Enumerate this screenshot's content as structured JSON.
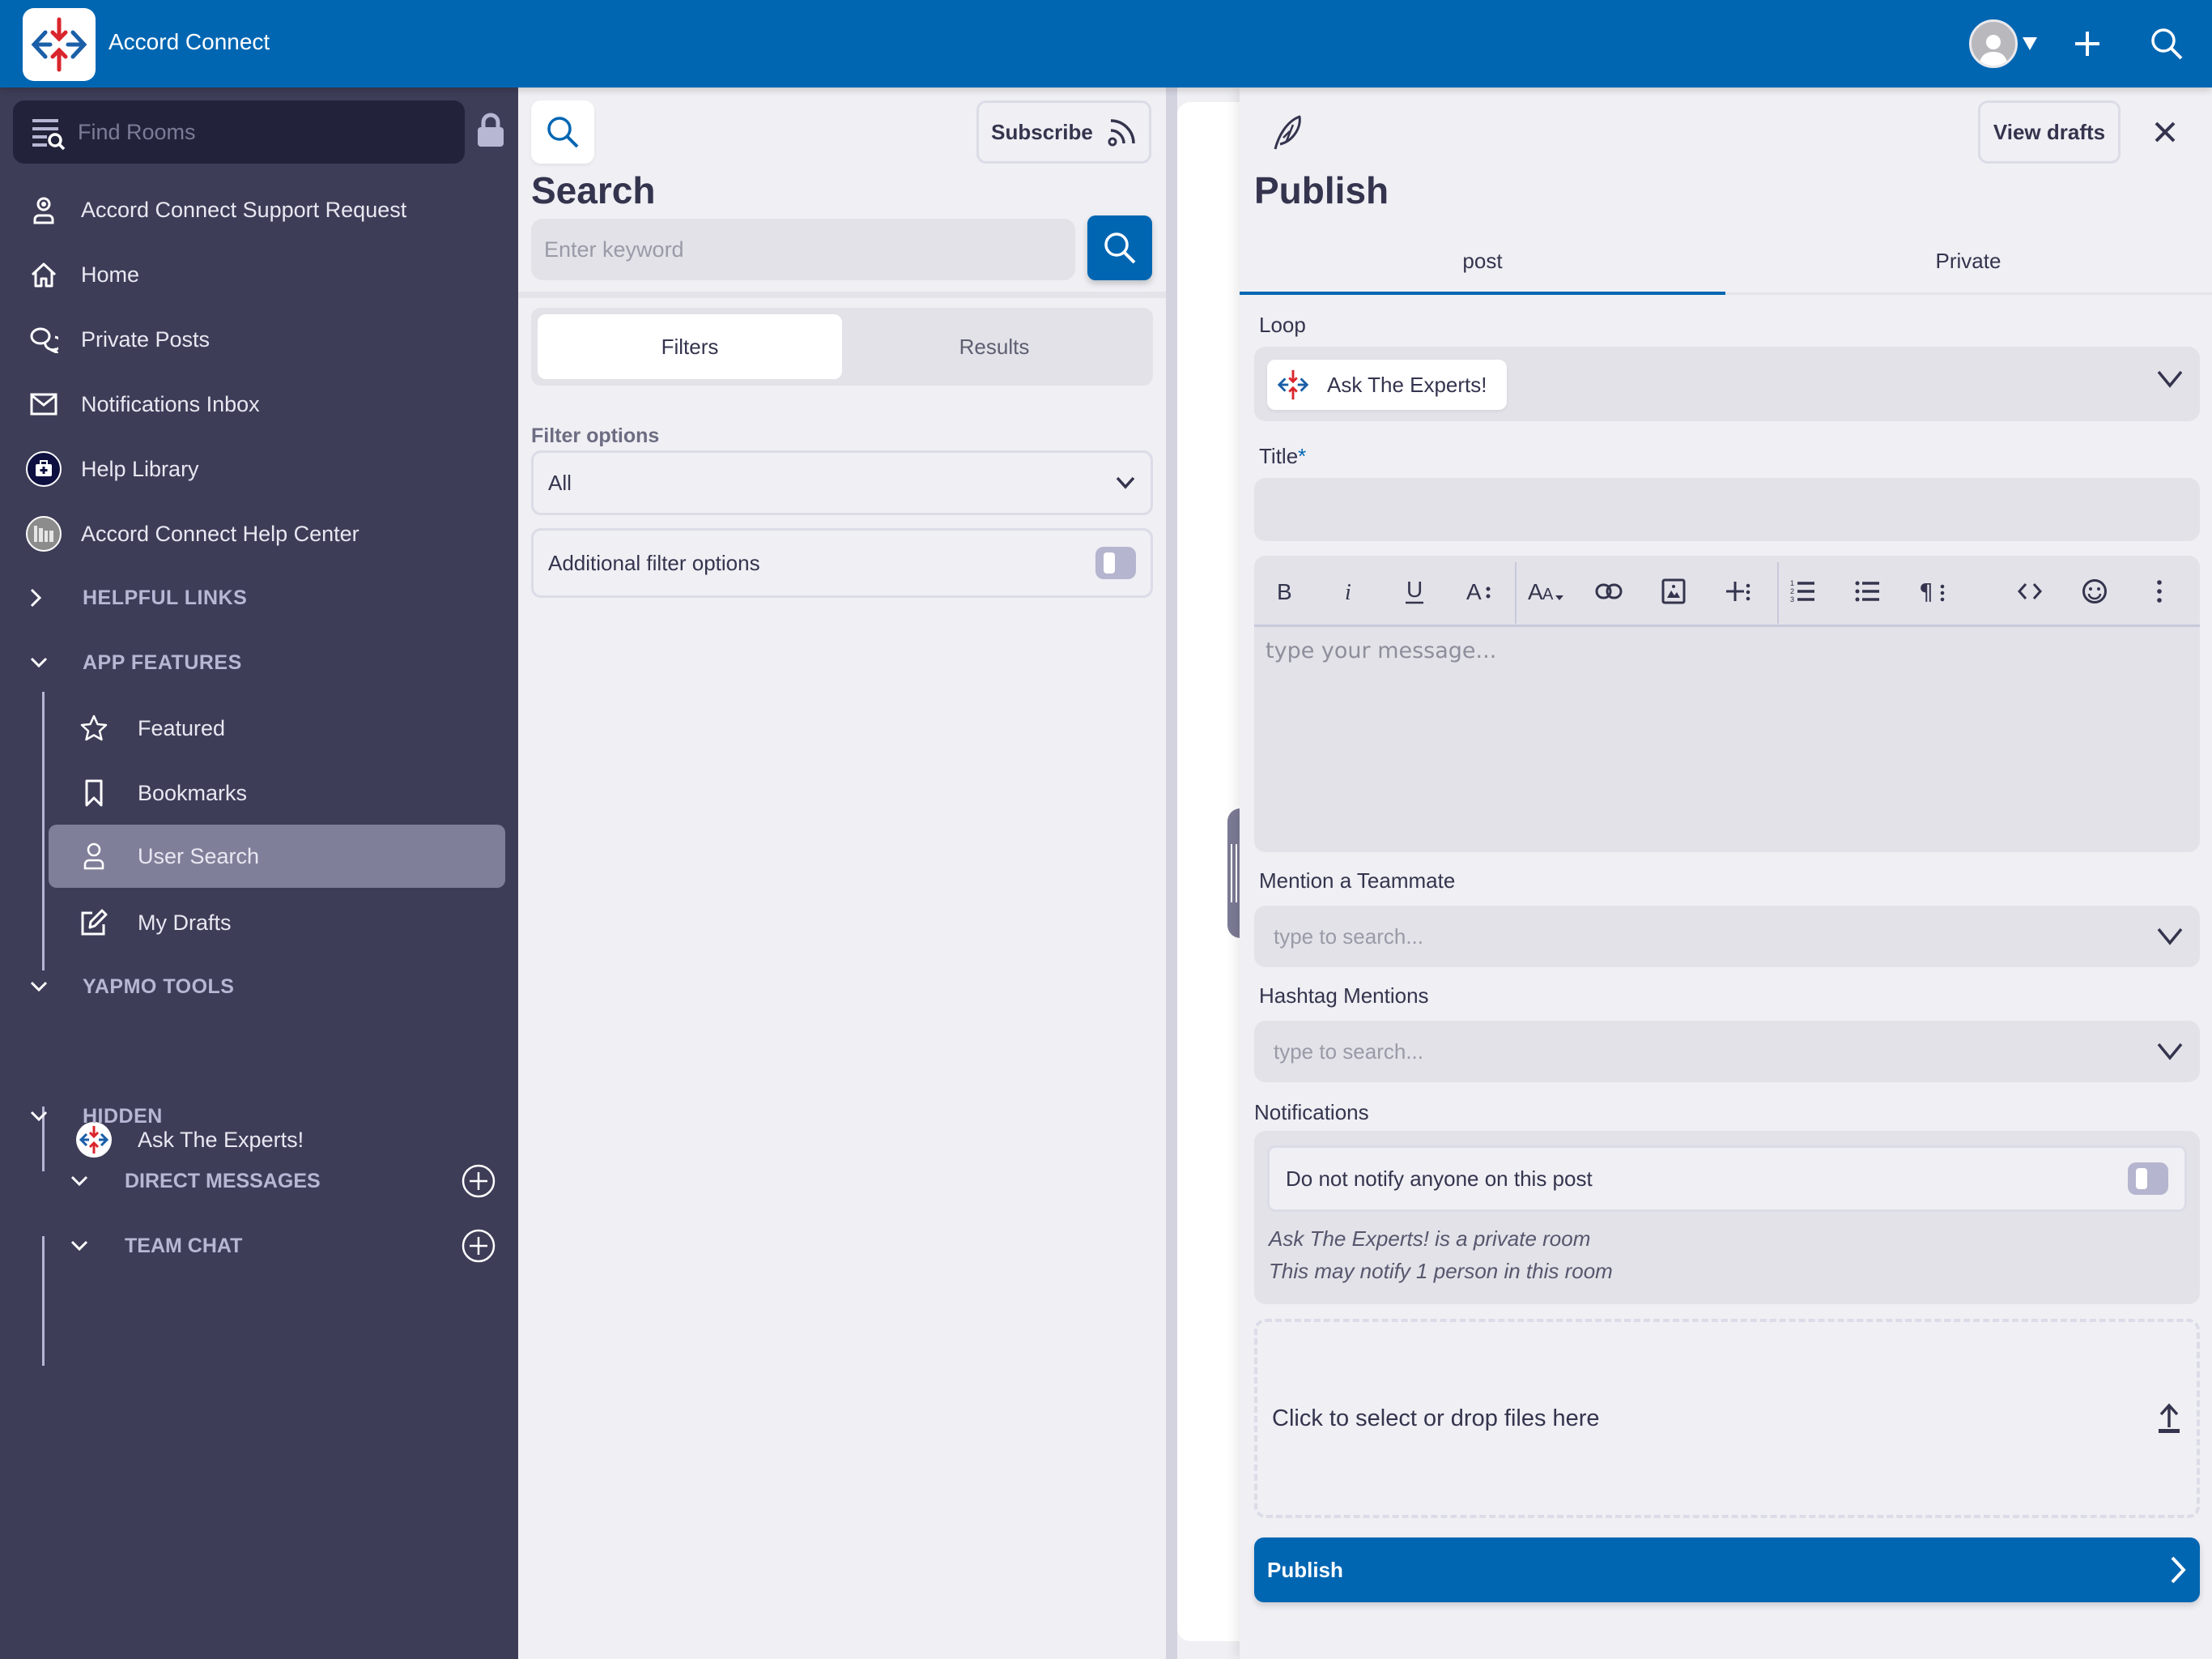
{
  "app": {
    "title": "Accord Connect",
    "brand_color": "#0066b2",
    "sidebar_color": "#3d3d58"
  },
  "header": {
    "icons": [
      "user-avatar-icon",
      "plus-icon",
      "search-icon"
    ]
  },
  "sidebar": {
    "find_rooms_placeholder": "Find Rooms",
    "items": [
      {
        "label": "Accord Connect Support Request",
        "icon": "support-agent-icon"
      },
      {
        "label": "Home",
        "icon": "home-icon"
      },
      {
        "label": "Private Posts",
        "icon": "chat-bubbles-icon"
      },
      {
        "label": "Notifications Inbox",
        "icon": "envelope-icon"
      },
      {
        "label": "Help Library",
        "icon": "medical-kit-icon"
      },
      {
        "label": "Accord Connect Help Center",
        "icon": "library-books-icon"
      }
    ],
    "sections": [
      {
        "label": "HELPFUL LINKS",
        "expanded": false
      },
      {
        "label": "APP FEATURES",
        "expanded": true,
        "items": [
          {
            "label": "Featured",
            "icon": "star-icon"
          },
          {
            "label": "Bookmarks",
            "icon": "bookmark-icon"
          },
          {
            "label": "User Search",
            "icon": "user-icon",
            "active": true
          },
          {
            "label": "My Drafts",
            "icon": "edit-icon"
          }
        ]
      },
      {
        "label": "YAPMO TOOLS",
        "expanded": true,
        "items": [
          {
            "label": "Ask The Experts!",
            "icon": "accord-logo-icon"
          }
        ]
      },
      {
        "label": "HIDDEN",
        "expanded": true,
        "subsections": [
          {
            "label": "DIRECT MESSAGES"
          },
          {
            "label": "TEAM CHAT"
          }
        ]
      }
    ]
  },
  "search_panel": {
    "subscribe_label": "Subscribe",
    "heading": "Search",
    "keyword_placeholder": "Enter keyword",
    "keyword_value": "",
    "tabs": [
      {
        "label": "Filters",
        "active": true
      },
      {
        "label": "Results",
        "active": false
      }
    ],
    "filter_options_label": "Filter options",
    "filter_selected": "All",
    "additional_filter_label": "Additional filter options",
    "additional_filter_on": false
  },
  "publish": {
    "view_drafts_label": "View drafts",
    "heading": "Publish",
    "tabs": [
      {
        "label": "post",
        "active": true
      },
      {
        "label": "Private",
        "active": false
      }
    ],
    "loop_label": "Loop",
    "loop_selected": "Ask The Experts!",
    "title_label": "Title",
    "title_required_mark": "*",
    "title_value": "",
    "toolbar": [
      "bold",
      "italic",
      "underline",
      "text-style",
      "font-size",
      "link",
      "image",
      "insert",
      "ordered-list",
      "unordered-list",
      "paragraph",
      "code",
      "emoji",
      "more"
    ],
    "message_placeholder": "type your message...",
    "mention_label": "Mention a Teammate",
    "mention_placeholder": "type to search...",
    "hashtag_label": "Hashtag Mentions",
    "hashtag_placeholder": "type to search...",
    "notifications_label": "Notifications",
    "do_not_notify_label": "Do not notify anyone on this post",
    "do_not_notify_on": false,
    "notes": [
      "Ask The Experts! is a private room",
      "This may notify 1 person in this room"
    ],
    "dropzone_label": "Click to select or drop files here",
    "publish_button_label": "Publish"
  }
}
